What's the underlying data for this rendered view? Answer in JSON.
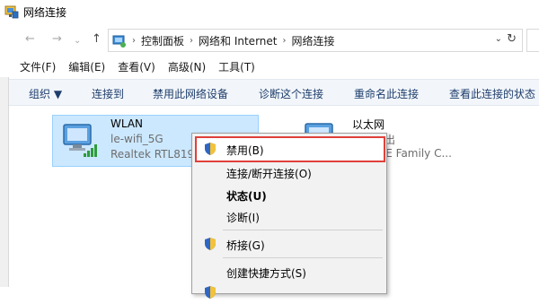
{
  "window": {
    "title": "网络连接"
  },
  "address": {
    "crumbs": [
      "控制面板",
      "网络和 Internet",
      "网络连接"
    ]
  },
  "menubar": {
    "items": [
      "文件(F)",
      "编辑(E)",
      "查看(V)",
      "高级(N)",
      "工具(T)"
    ]
  },
  "commandbar": {
    "organize": "组织 ▼",
    "connect_to": "连接到",
    "disable_device": "禁用此网络设备",
    "diagnose": "诊断这个连接",
    "rename": "重命名此连接",
    "view_status": "查看此连接的状态"
  },
  "adapters": {
    "wlan": {
      "name": "WLAN",
      "ssid": "le-wifi_5G",
      "device": "Realtek RTL819"
    },
    "ethernet": {
      "name": "以太网",
      "status": "缆被拔出",
      "device": "PCIe FE Family C..."
    }
  },
  "context_menu": {
    "disable": "禁用(B)",
    "connect": "连接/断开连接(O)",
    "status": "状态(U)",
    "diagnose": "诊断(I)",
    "bridge": "桥接(G)",
    "shortcut": "创建快捷方式(S)"
  },
  "colors": {
    "selection_bg": "#cce8ff",
    "highlight_border": "#e0403a",
    "commandbar_text": "#1e3d6b"
  }
}
